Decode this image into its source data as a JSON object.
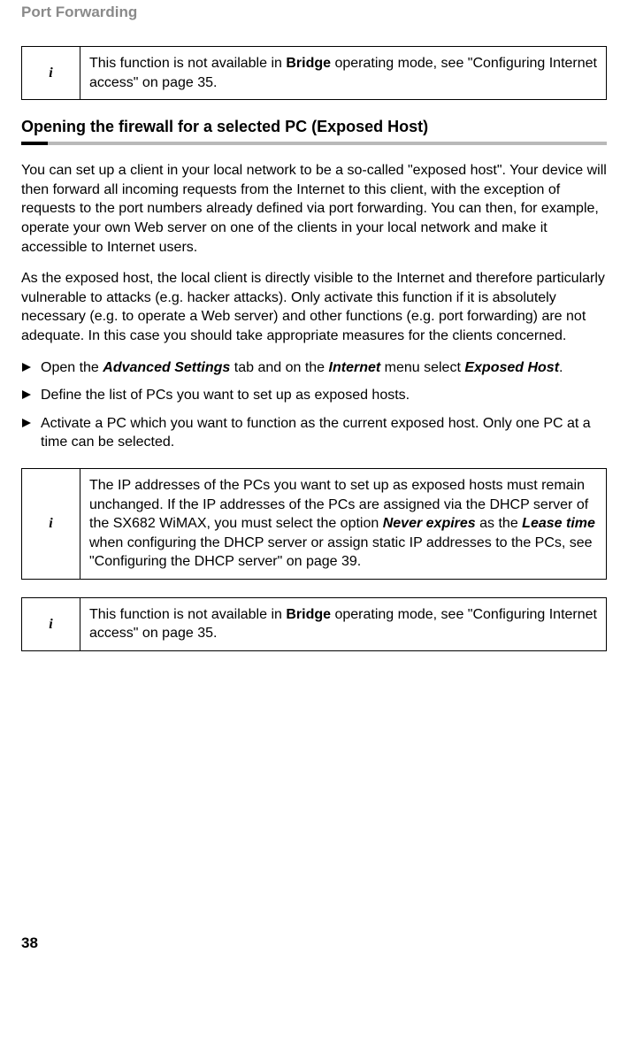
{
  "runningHead": "Port Forwarding",
  "info1": {
    "pre": "This function is not available in ",
    "bold": "Bridge",
    "post": " operating mode, see \"Configuring Internet access\" on page 35."
  },
  "heading": "Opening the firewall for a selected PC (Exposed Host)",
  "para1": "You can set up a client in your local network to be a so-called \"exposed host\". Your device will then forward all incoming requests from the Internet to this client, with the exception of requests to the port numbers already defined via port forwarding. You can then, for example, operate your own Web server on one of the clients in your local network and make it accessible to Internet users.",
  "para2": "As the exposed host, the local client is directly visible to the Internet and therefore particularly vulnerable to attacks (e.g. hacker attacks). Only activate this function if it is absolutely necessary (e.g. to operate a Web server) and other functions (e.g. port forwarding) are not adequate. In this case you should take appropriate measures for the clients concerned.",
  "step1": {
    "a": "Open the ",
    "b": "Advanced Settings",
    "c": " tab and on the ",
    "d": "Internet",
    "e": " menu select ",
    "f": "Exposed Host",
    "g": "."
  },
  "step2": "Define the list of PCs you want to set up as exposed hosts.",
  "step3": "Activate a PC which you want to function as the current exposed host. Only one PC at a time can be selected.",
  "info2": {
    "a": "The IP addresses of the PCs you want to set up as exposed hosts must remain unchanged. If the IP addresses of the PCs are assigned via the DHCP server of the SX682 WiMAX, you must select the option ",
    "b": "Never expires",
    "c": " as the ",
    "d": "Lease time",
    "e": " when configuring the DHCP server or assign static IP addresses to the PCs, see \"Configuring the DHCP server\" on page 39."
  },
  "info3": {
    "pre": "This function is not available in ",
    "bold": "Bridge",
    "post": " operating mode, see \"Configuring Internet access\" on page 35."
  },
  "pageNumber": "38",
  "iconGlyph": "i"
}
